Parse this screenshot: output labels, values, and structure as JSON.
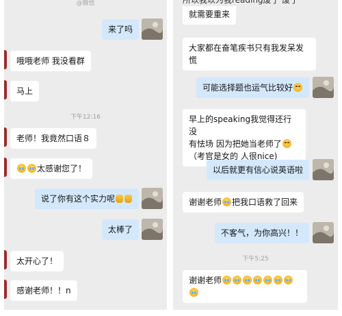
{
  "left": {
    "top_cut": "@微信",
    "messages": [
      {
        "text": "来了吗"
      },
      {
        "text": "哦哦老师 我没看群"
      },
      {
        "text": "马上"
      },
      {
        "text": "老师！我竟然口语８"
      },
      {
        "text": "太感谢您了！"
      },
      {
        "text": "说了你有这个实力呢"
      },
      {
        "text": "太棒了"
      },
      {
        "text": "太开心了！"
      },
      {
        "text": "感谢老师！！n"
      }
    ],
    "timestamp": "下午12:16"
  },
  "right": {
    "top_cut": "所以我以为我reading废了 废了",
    "messages": [
      {
        "text": "就需要重来"
      },
      {
        "line1": "大家都在奋笔疾书只有我发呆发",
        "line2": "慌"
      },
      {
        "text": "可能选择题也运气比较好"
      },
      {
        "line1": "早上的speaking我觉得还行 没",
        "line2": "有怯场 因为把她当老师了",
        "line3": "（考官是女的 人很nice)"
      },
      {
        "text": "以后就更有信心说英语啦"
      },
      {
        "pre": "谢谢老师",
        "post": "把我口语救了回来"
      },
      {
        "text": "不客气，为你高兴！！"
      },
      {
        "text": "谢谢老师"
      }
    ],
    "timestamp": "下午5:25"
  },
  "colors": {
    "panel_bg": "#ececec",
    "received_bubble": "#ffffff",
    "sent_bubble": "#d4e8fb"
  }
}
